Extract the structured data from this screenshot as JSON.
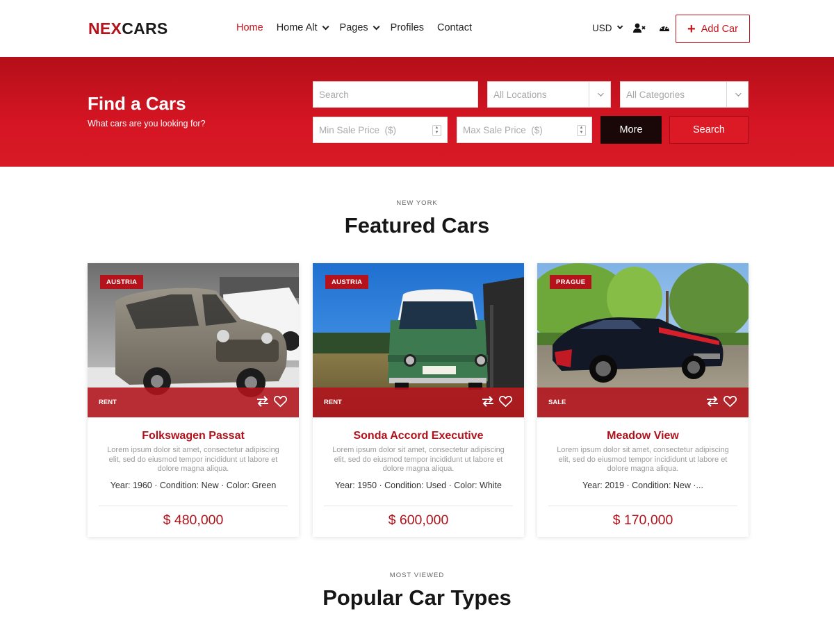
{
  "brand": {
    "part1": "NEX",
    "part2": "CARS"
  },
  "nav": {
    "items": [
      {
        "label": "Home",
        "active": true,
        "dropdown": false
      },
      {
        "label": "Home Alt",
        "active": false,
        "dropdown": true
      },
      {
        "label": "Pages",
        "active": false,
        "dropdown": true
      },
      {
        "label": "Profiles",
        "active": false,
        "dropdown": false
      },
      {
        "label": "Contact",
        "active": false,
        "dropdown": false
      }
    ]
  },
  "header_tools": {
    "currency": "USD",
    "icons": [
      "user-remove-icon",
      "dashboard-gauge-icon"
    ],
    "add_car_label": "Add Car"
  },
  "hero": {
    "title": "Find a Cars",
    "subtitle": "What cars are you looking for?",
    "search_placeholder": "Search",
    "location_select": "All Locations",
    "category_select": "All Categories",
    "min_price_placeholder": "Min Sale Price  ($)",
    "max_price_placeholder": "Max Sale Price  ($)",
    "more_label": "More",
    "search_label": "Search"
  },
  "featured": {
    "eyebrow": "NEW YORK",
    "title": "Featured Cars",
    "cards": [
      {
        "location": "AUSTRIA",
        "deal": "RENT",
        "name": "Folkswagen Passat",
        "desc": "Lorem ipsum dolor sit amet, consectetur adipiscing elit, sed do eiusmod tempor incididunt ut labore et dolore magna aliqua.",
        "specs": "Year: 1960  ·   Condition: New  ·   Color: Green",
        "price": "$ 480,000"
      },
      {
        "location": "AUSTRIA",
        "deal": "RENT",
        "name": "Sonda Accord Executive",
        "desc": "Lorem ipsum dolor sit amet, consectetur adipiscing elit, sed do eiusmod tempor incididunt ut labore et dolore magna aliqua.",
        "specs": "Year: 1950  ·   Condition: Used  ·   Color: White",
        "price": "$ 600,000"
      },
      {
        "location": "PRAGUE",
        "deal": "SALE",
        "name": "Meadow View",
        "desc": "Lorem ipsum dolor sit amet, consectetur adipiscing elit, sed do eiusmod tempor incididunt ut labore et dolore magna aliqua.",
        "specs": "Year: 2019  ·   Condition: New  ·...",
        "price": "$ 170,000"
      }
    ]
  },
  "popular": {
    "eyebrow": "MOST VIEWED",
    "title": "Popular Car Types"
  },
  "colors": {
    "brand_red": "#c3141e",
    "hero_red": "#d51523",
    "dark_button": "#1a0707"
  }
}
